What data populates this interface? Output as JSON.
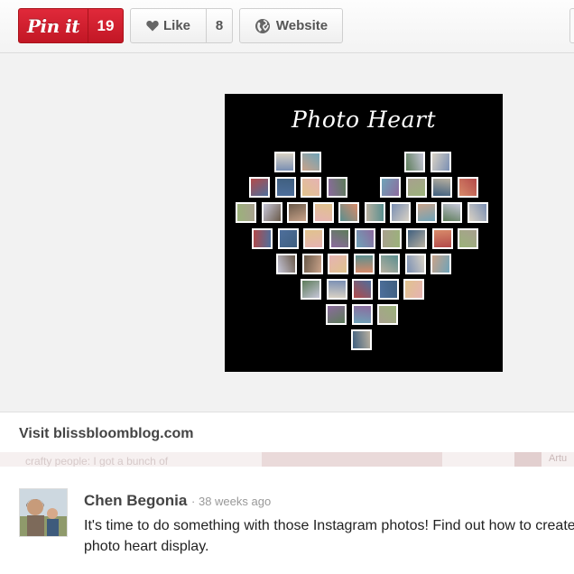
{
  "toolbar": {
    "pin_label": "Pin it",
    "pin_count": "19",
    "like_label": "Like",
    "like_count": "8",
    "website_label": "Website"
  },
  "pin_image": {
    "title": "Photo Heart"
  },
  "visit": {
    "label": "Visit blissbloomblog.com"
  },
  "background_strip": {
    "text": "crafty people: I got a bunch of",
    "tag": "Artu"
  },
  "comment": {
    "author": "Chen Begonia",
    "timestamp": "· 38 weeks ago",
    "text": "It's time to do something with those Instagram photos! Find out how to create a photo heart display."
  },
  "colors": {
    "pin_red": "#cb2027",
    "photo_background": "#000000"
  },
  "icons": {
    "like": "heart-icon",
    "website": "globe-icon",
    "pin": "pinterest-logo"
  }
}
